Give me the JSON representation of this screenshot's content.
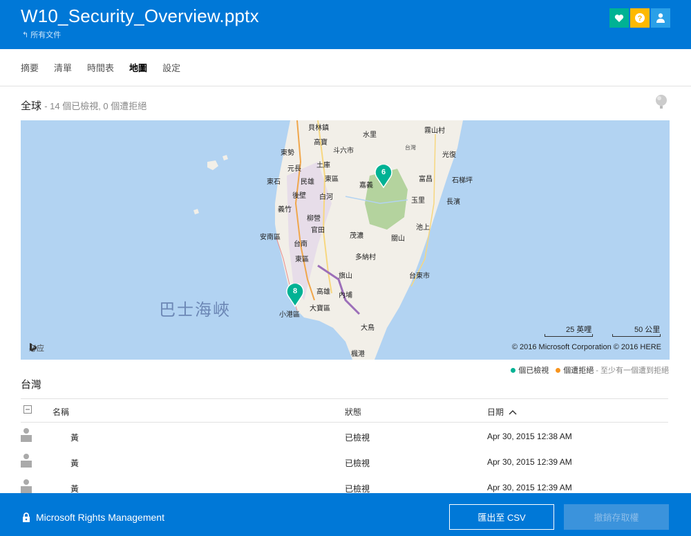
{
  "header": {
    "title": "W10_Security_Overview.pptx",
    "back_link": "所有文件",
    "icons": [
      "heart-icon",
      "question-icon",
      "person-icon"
    ],
    "colors": {
      "bar": "#0078d7",
      "heart": "#00b294",
      "help": "#ffb900",
      "user": "#2aa0e8"
    }
  },
  "tabs": [
    {
      "label": "摘要"
    },
    {
      "label": "清單"
    },
    {
      "label": "時間表"
    },
    {
      "label": "地圖",
      "active": true
    },
    {
      "label": "設定"
    }
  ],
  "global": {
    "title": "全球",
    "summary": "- 14 個已檢視, 0 個遭拒絕"
  },
  "map": {
    "sea_label": "巴士海峽",
    "places": [
      "貝林鎮",
      "水里",
      "霧山村",
      "高寶",
      "東勢",
      "斗六市",
      "光復",
      "元長",
      "土庫",
      "東石",
      "民雄",
      "東區",
      "嘉義",
      "富昌",
      "石梯坪",
      "後壁",
      "白河",
      "玉里",
      "長濱",
      "義竹",
      "柳營",
      "官田",
      "池上",
      "安南區",
      "台南",
      "茂濃",
      "關山",
      "東區",
      "多納村",
      "旗山",
      "台東市",
      "高雄",
      "內埔",
      "小港區",
      "大寶區",
      "大鳥",
      "楓港",
      "台灣"
    ],
    "pins": [
      {
        "count": "6"
      },
      {
        "count": "8"
      }
    ],
    "scale_miles": "25 英哩",
    "scale_km": "50 公里",
    "bing_label": "必应",
    "copyright": "© 2016 Microsoft Corporation   © 2016 HERE"
  },
  "legend": {
    "viewed": "個已檢視",
    "denied": "個遭拒絕",
    "note": "- 至少有一個遭到拒絕",
    "viewed_color": "#00b294",
    "denied_color": "#f7941d"
  },
  "country": "台灣",
  "table": {
    "columns": [
      "名稱",
      "狀態",
      "日期"
    ],
    "rows": [
      {
        "name": "黃",
        "status": "已檢視",
        "date": "Apr 30, 2015 12:38 AM"
      },
      {
        "name": "黃",
        "status": "已檢視",
        "date": "Apr 30, 2015 12:39 AM"
      },
      {
        "name": "黃",
        "status": "已檢視",
        "date": "Apr 30, 2015 12:39 AM"
      }
    ]
  },
  "footer": {
    "brand": "Microsoft Rights Management",
    "export_label": "匯出至 CSV",
    "revoke_label": "撤銷存取權"
  }
}
